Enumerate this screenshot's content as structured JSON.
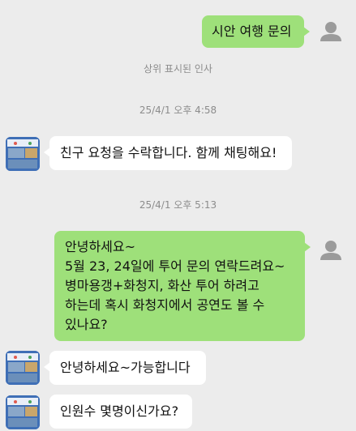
{
  "messages": [
    {
      "text": "시안 여행 문의"
    },
    {
      "text": "상위 표시된 인사"
    },
    {
      "text": "25/4/1 오후 4:58"
    },
    {
      "text": "친구 요청을 수락합니다. 함께 채팅해요!"
    },
    {
      "text": "25/4/1 오후 5:13"
    },
    {
      "lines": [
        "안녕하세요~",
        "5월 23, 24일에 투어 문의 연락드려요~",
        "병마용갱+화청지, 화산 투어 하려고",
        "하는데 혹시 화청지에서 공연도 볼 수",
        "있나요?"
      ]
    },
    {
      "text": "안녕하세요~가능합니다"
    },
    {
      "text": "인원수 몇명이신가요?"
    }
  ],
  "colors": {
    "background": "#ececec",
    "mine_bubble": "#9ee07a",
    "theirs_bubble": "#ffffff",
    "system_text": "#8c8c8c"
  }
}
